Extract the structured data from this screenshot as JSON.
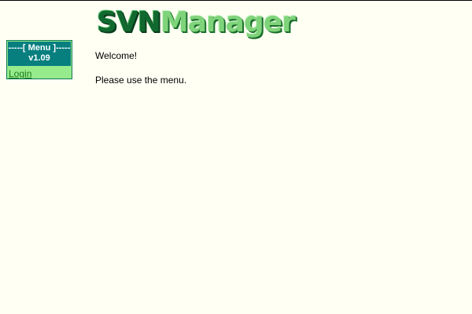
{
  "logo": {
    "part1": "SVN",
    "part2": "Manager"
  },
  "menu": {
    "header_line1": "-----[ Menu ]-----",
    "header_line2": "v1.09",
    "items": [
      {
        "label": "Login"
      }
    ]
  },
  "main": {
    "welcome": "Welcome!",
    "instruction": "Please use the menu."
  }
}
